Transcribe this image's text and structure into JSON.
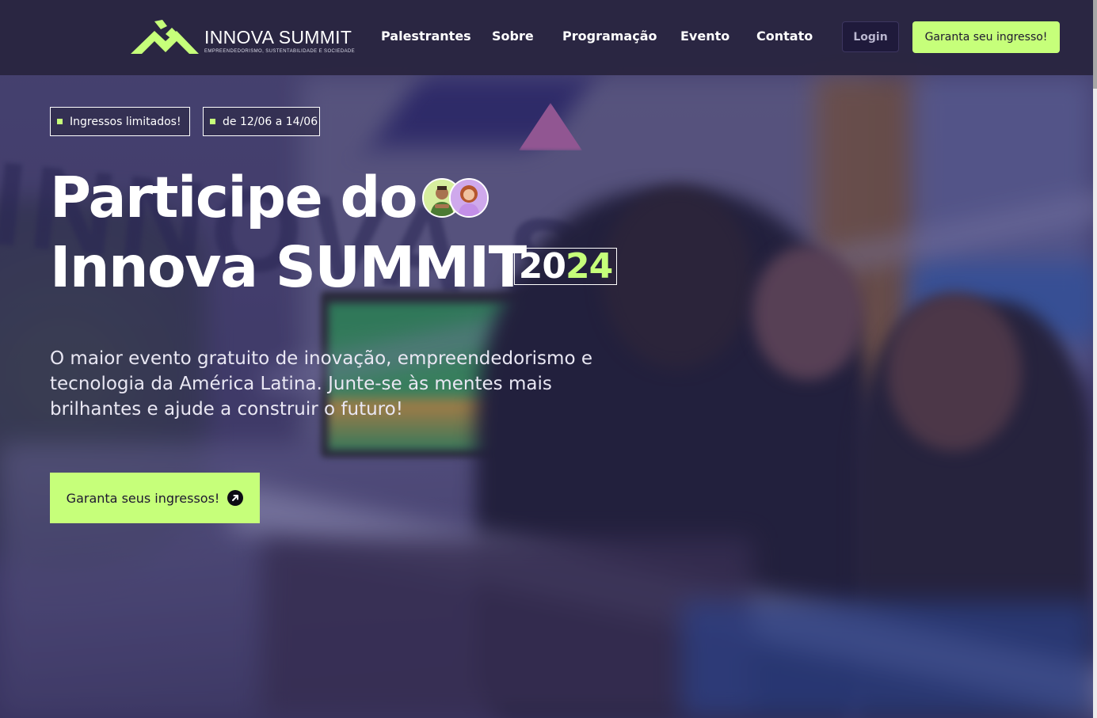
{
  "header": {
    "brand_name": "INNOVA SUMMIT",
    "brand_tagline": "EMPREENDEDORISMO, SUSTENTABILIDADE E SOCIEDADE",
    "nav": [
      {
        "label": "Palestrantes"
      },
      {
        "label": "Sobre"
      },
      {
        "label": "Programação"
      },
      {
        "label": "Evento"
      },
      {
        "label": "Contato"
      }
    ],
    "login_label": "Login",
    "ticket_label": "Garanta seu ingresso!"
  },
  "hero": {
    "chips": [
      {
        "label": "Ingressos limitados!"
      },
      {
        "label": "de 12/06 a 14/06"
      }
    ],
    "title_line1": "Participe do",
    "title_line2": "Innova SUMMIT",
    "year_part1": "20",
    "year_part2": "24",
    "description": "O maior evento gratuito de inovação, empreendedorismo e tecnologia da América Latina. Junte-se às mentes mais brilhantes e ajude a construir o futuro!",
    "cta_label": "Garanta seus ingressos!"
  },
  "colors": {
    "accent": "#c6ff7a",
    "header_bg": "#28243e",
    "login_bg": "#1f1a3b",
    "text_dark": "#1d1730"
  },
  "icons": {
    "logo": "innova-summit-logo-icon",
    "cta": "arrow-up-right-circle-icon"
  }
}
